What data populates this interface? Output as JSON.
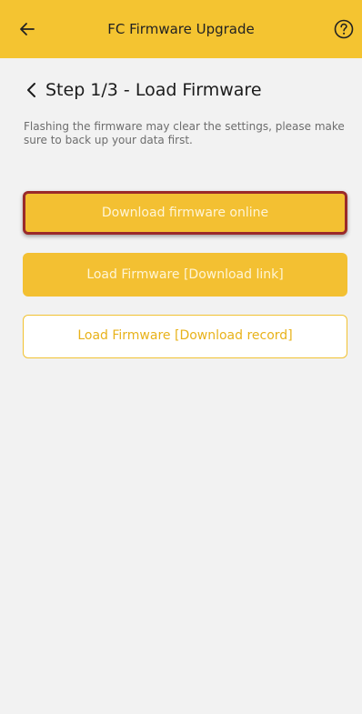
{
  "colors": {
    "accent": "#f4c431",
    "background": "#f2f2f2",
    "highlight_border": "#9a2a2a"
  },
  "header": {
    "title": "FC Firmware Upgrade",
    "back_icon": "arrow-left-icon",
    "help_icon": "question-circle-icon"
  },
  "step": {
    "chevron_icon": "chevron-left-icon",
    "title": "Step 1/3 - Load Firmware"
  },
  "warning_text": "Flashing the firmware may clear the settings, please make sure to back up your data first.",
  "buttons": {
    "download_online": "Download firmware online",
    "load_link": "Load Firmware [Download link]",
    "load_record": "Load Firmware [Download record]"
  }
}
